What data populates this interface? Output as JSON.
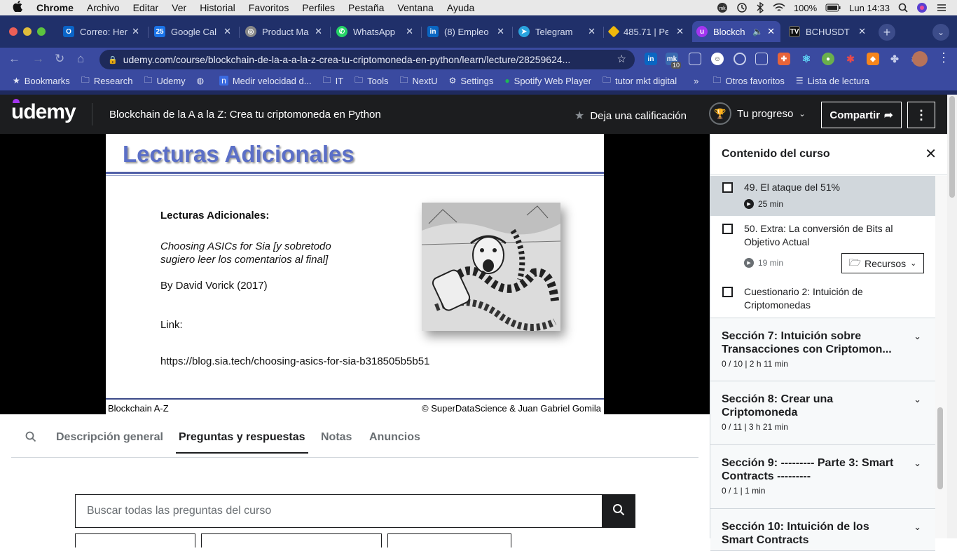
{
  "macos_menu": {
    "app": "Chrome",
    "items": [
      "Archivo",
      "Editar",
      "Ver",
      "Historial",
      "Favoritos",
      "Perfiles",
      "Pestaña",
      "Ventana",
      "Ayuda"
    ],
    "battery": "100%",
    "clock": "Lun 14:33"
  },
  "tabs": [
    {
      "title": "Correo: Her",
      "icon": "outlook-icon",
      "color": "#0a64c8"
    },
    {
      "title": "Google Cal",
      "icon": "calendar-icon",
      "color": "#1a73e8"
    },
    {
      "title": "Product Ma",
      "icon": "product-icon",
      "color": "#888888"
    },
    {
      "title": "WhatsApp",
      "icon": "whatsapp-icon",
      "color": "#25d366"
    },
    {
      "title": "(8) Empleo",
      "icon": "linkedin-icon",
      "color": "#0a66c2"
    },
    {
      "title": "Telegram",
      "icon": "telegram-icon",
      "color": "#2aa3de"
    },
    {
      "title": "485.71 | Pe",
      "icon": "binance-icon",
      "color": "#f0b90b"
    },
    {
      "title": "Blockch",
      "icon": "udemy-icon",
      "color": "#a435f0"
    },
    {
      "title": "BCHUSDT",
      "icon": "tradingview-icon",
      "color": "#111111"
    }
  ],
  "omnibox": {
    "url": "udemy.com/course/blockchain-de-la-a-a-la-z-crea-tu-criptomoneda-en-python/learn/lecture/28259624..."
  },
  "extensions": {
    "badge_1": "10"
  },
  "bookmarks": {
    "items": [
      "Bookmarks",
      "Research",
      "Udemy",
      "Medir velocidad d...",
      "IT",
      "Tools",
      "NextU",
      "Settings",
      "Spotify Web Player",
      "tutor mkt digital"
    ],
    "overflow": "»",
    "other": "Otros favoritos",
    "reading": "Lista de lectura"
  },
  "header": {
    "logo": "udemy",
    "course_title": "Blockchain de la A a la Z: Crea tu criptomoneda en Python",
    "rate": "Deja una calificación",
    "progress": "Tu progreso",
    "share": "Compartir"
  },
  "slide": {
    "title": "Lecturas Adicionales",
    "heading": "Lecturas Adicionales:",
    "ref_line1": "Choosing ASICs for Sia [y sobretodo",
    "ref_line2": "sugiero leer los comentarios al final]",
    "author": "By David Vorick (2017)",
    "link_label": "Link:",
    "link": "https://blog.sia.tech/choosing-asics-for-sia-b318505b5b51",
    "footer_left": "Blockchain A-Z",
    "footer_right": "© SuperDataScience & Juan Gabriel Gomila"
  },
  "content_tabs": [
    "Descripción general",
    "Preguntas y respuestas",
    "Notas",
    "Anuncios"
  ],
  "search": {
    "placeholder": "Buscar todas las preguntas del curso"
  },
  "sidebar": {
    "title": "Contenido del curso",
    "lectures": [
      {
        "title": "49. El ataque del 51%",
        "duration": "25 min"
      },
      {
        "title": "50. Extra: La conversión de Bits al Objetivo Actual",
        "duration": "19 min",
        "resources": "Recursos"
      },
      {
        "title": "Cuestionario 2: Intuición de Criptomonedas"
      }
    ],
    "sections": [
      {
        "title": "Sección 7: Intuición sobre Transacciones con Criptomon...",
        "meta": "0 / 10 | 2 h 11 min"
      },
      {
        "title": "Sección 8: Crear una Criptomoneda",
        "meta": "0 / 11 | 3 h 21 min"
      },
      {
        "title": "Sección 9: --------- Parte 3: Smart Contracts ---------",
        "meta": "0 / 1 | 1 min"
      },
      {
        "title": "Sección 10: Intuición de los Smart Contracts",
        "meta": ""
      }
    ]
  }
}
